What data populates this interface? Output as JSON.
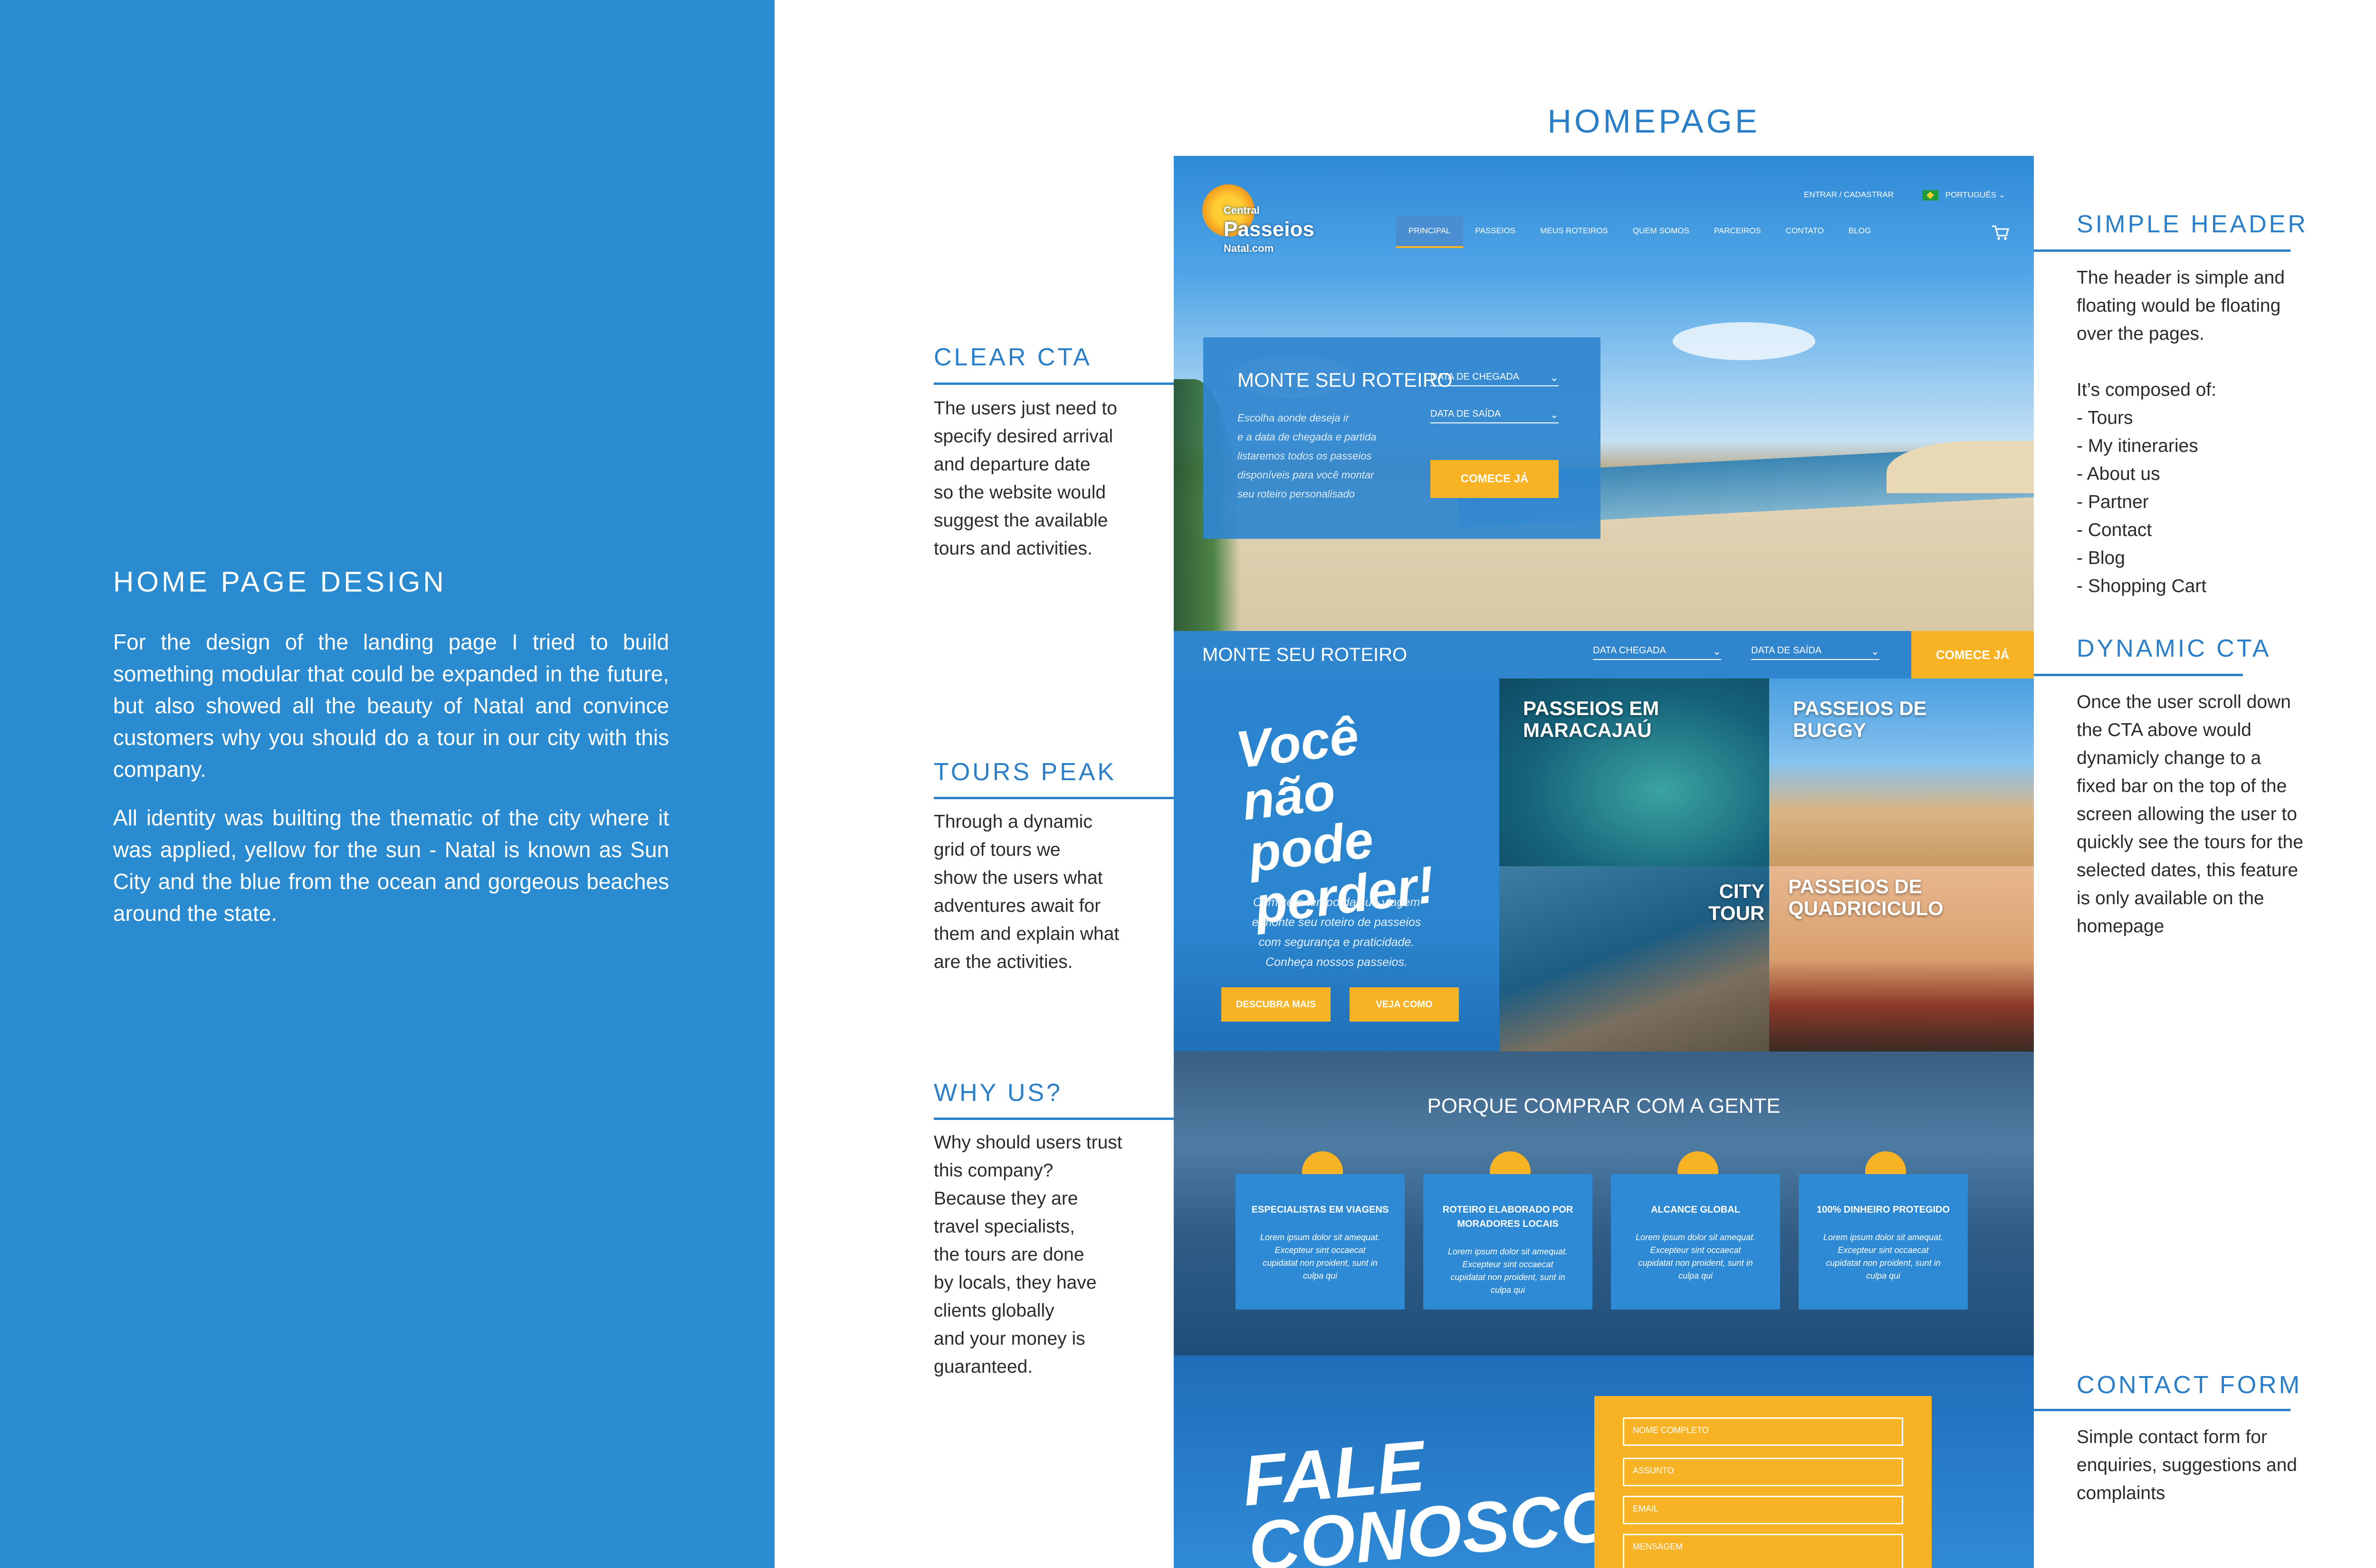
{
  "left_panel": {
    "title": "HOME PAGE DESIGN",
    "paragraph_1": "For the design of the landing page I tried to build something modular that could be expanded in the future, but also showed all the beauty of Natal and convince customers why you should do a tour in our city with this company.",
    "paragraph_2": "All identity was builting the thematic of the city where it was applied, yellow for the sun - Natal is known as Sun City and the blue from the ocean and gorgeous beaches around the state."
  },
  "homepage_title": "HOMEPAGE",
  "annotations": {
    "clear_cta": {
      "title": "CLEAR CTA",
      "text": "The users just need to\nspecify desired arrival\nand departure date\nso the website would\nsuggest the available\ntours and activities."
    },
    "tours_peak": {
      "title": "TOURS PEAK",
      "text": "Through a dynamic\ngrid of tours we\nshow the users what\nadventures await for\nthem and explain what\nare the activities."
    },
    "why_us": {
      "title": "WHY US?",
      "text": "Why should users trust\nthis company?\nBecause they are\ntravel specialists,\nthe tours are done\nby locals, they have\nclients globally\nand your money is\nguaranteed."
    },
    "simple_header": {
      "title": "SIMPLE HEADER",
      "text": "The header is simple and\nfloating would be floating\nover the pages.\n\nIt’s composed of:\n- Tours\n- My itineraries\n- About us\n- Partner\n- Contact\n- Blog\n- Shopping Cart"
    },
    "dynamic_cta": {
      "title": "DYNAMIC CTA",
      "text": "Once the user scroll down\nthe CTA above would\ndynamicly change to a\nfixed bar on the top of the\nscreen allowing the user to\nquickly see the tours for the\nselected dates, this feature\nis only available on the\nhomepage"
    },
    "contact_form": {
      "title": "CONTACT FORM",
      "text": "Simple contact form for\nenquiries, suggestions and\ncomplaints"
    }
  },
  "mockup": {
    "logo": {
      "line1": "Central",
      "line2": "Passeios",
      "line3": "Natal.com"
    },
    "topnav": {
      "login": "ENTRAR / CADASTRAR",
      "language": "PORTUGUÊS"
    },
    "nav": [
      "PRINCIPAL",
      "PASSEIOS",
      "MEUS ROTEIROS",
      "QUEM SOMOS",
      "PARCEIROS",
      "CONTATO",
      "BLOG"
    ],
    "cta": {
      "title": "MONTE SEU ROTEIRO",
      "description": "Escolha aonde deseja ir\ne a data de chegada e partida\nlistaremos todos os passeios\ndisponíveis para você montar\nseu roteiro personalisado",
      "arrival": "DATA DE CHEGADA",
      "departure": "DATA DE SAÍDA",
      "button": "COMECE JÁ"
    },
    "dynamic_bar": {
      "title": "MONTE SEU ROTEIRO",
      "arrival": "DATA CHEGADA",
      "departure": "DATA DE SAÍDA",
      "button": "COMECE JÁ"
    },
    "promo": {
      "headline": "Você não pode perder!",
      "description": "Otimize o tempo da sua viagem\ne monte seu roteiro de passeios\ncom segurança e praticidade.\nConheça nossos passeios.",
      "button_1": "DESCUBRA MAIS",
      "button_2": "VEJA COMO"
    },
    "tours": [
      {
        "label": "PASSEIOS EM\nMARACAJAÚ"
      },
      {
        "label": "PASSEIOS DE\nBUGGY"
      },
      {
        "label": "CITY\nTOUR"
      },
      {
        "label": "PASSEIOS DE\nQUADRICICULO"
      }
    ],
    "why": {
      "title": "PORQUE COMPRAR COM A GENTE",
      "cards": [
        {
          "title": "ESPECIALISTAS EM VIAGENS",
          "body": "Lorem ipsum dolor sit amequat.\nExcepteur sint occaecat\ncupidatat non proident, sunt in\nculpa qui"
        },
        {
          "title": "ROTEIRO ELABORADO POR\nMORADORES LOCAIS",
          "body": "Lorem ipsum dolor sit amequat.\nExcepteur sint occaecat\ncupidatat non proident, sunt in\nculpa qui"
        },
        {
          "title": "ALCANCE GLOBAL",
          "body": "Lorem ipsum dolor sit amequat.\nExcepteur sint occaecat\ncupidatat non proident, sunt in\nculpa qui"
        },
        {
          "title": "100% DINHEIRO PROTEGIDO",
          "body": "Lorem ipsum dolor sit amequat.\nExcepteur sint occaecat\ncupidatat non proident, sunt in\nculpa qui"
        }
      ]
    },
    "contact": {
      "headline": "FALE\nCONOSCO",
      "fields": [
        "NOME COMPLETO",
        "ASSUNTO",
        "EMAIL",
        "MENSAGEM"
      ]
    }
  },
  "colors": {
    "panel_blue": "#2a8bd0",
    "brand_blue": "#2f86cf",
    "accent_yellow": "#f8b324",
    "annotation_blue": "#2a7fc8"
  }
}
